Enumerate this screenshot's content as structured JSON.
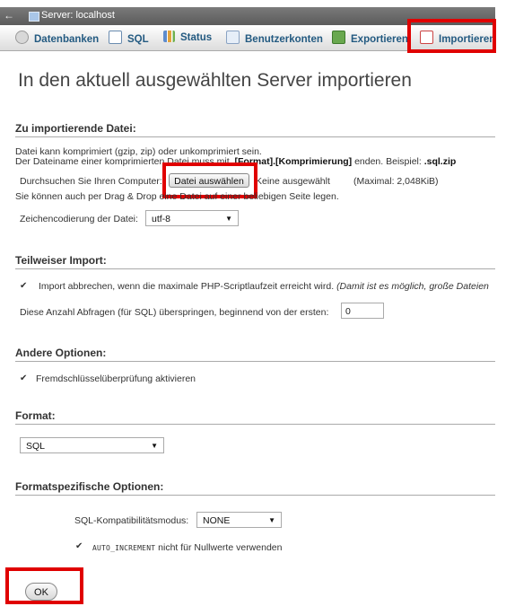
{
  "server_bar": {
    "back": "←",
    "label": "Server:",
    "name": "localhost"
  },
  "tabs": [
    {
      "label": "Datenbanken"
    },
    {
      "label": "SQL"
    },
    {
      "label": "Status"
    },
    {
      "label": "Benutzerkonten"
    },
    {
      "label": "Exportieren"
    },
    {
      "label": "Importieren"
    }
  ],
  "page_title": "In den aktuell ausgewählten Server importieren",
  "file_section": {
    "heading": "Zu importierende Datei:",
    "line1": "Datei kann komprimiert (gzip, zip) oder unkomprimiert sein.",
    "line2_a": "Der Dateiname einer komprimierten Datei muss mit ",
    "line2_b": ".[Format].[Komprimierung]",
    "line2_c": " enden. Beispiel: ",
    "line2_d": ".sql.zip",
    "browse_label": "Durchsuchen Sie Ihren Computer:",
    "choose_button": "Datei auswählen",
    "no_file": "Keine ausgewählt",
    "max_size": "(Maximal: 2,048KiB)",
    "drag_drop": "Sie können auch per Drag & Drop eine Datei auf einer beliebigen Seite legen.",
    "charset_label": "Zeichencodierung der Datei:",
    "charset_value": "utf-8"
  },
  "partial_section": {
    "heading": "Teilweiser Import:",
    "abort_label": "Import abbrechen, wenn die maximale PHP-Scriptlaufzeit erreicht wird.",
    "abort_hint": "(Damit ist es möglich, große Dateien",
    "abort_checked": true,
    "skip_label": "Diese Anzahl Abfragen (für SQL) überspringen, beginnend von der ersten:",
    "skip_value": "0"
  },
  "other_section": {
    "heading": "Andere Optionen:",
    "fk_label": "Fremdschlüsselüberprüfung aktivieren",
    "fk_checked": true
  },
  "format_section": {
    "heading": "Format:",
    "format_value": "SQL"
  },
  "format_options": {
    "heading": "Formatspezifische Optionen:",
    "compat_label": "SQL-Kompatibilitätsmodus:",
    "compat_value": "NONE",
    "autoinc_code": "AUTO_INCREMENT",
    "autoinc_label": " nicht für Nullwerte verwenden",
    "autoinc_checked": true
  },
  "ok_button": "OK",
  "colors": {
    "highlight": "#e00000",
    "tab_text": "#235a81"
  }
}
